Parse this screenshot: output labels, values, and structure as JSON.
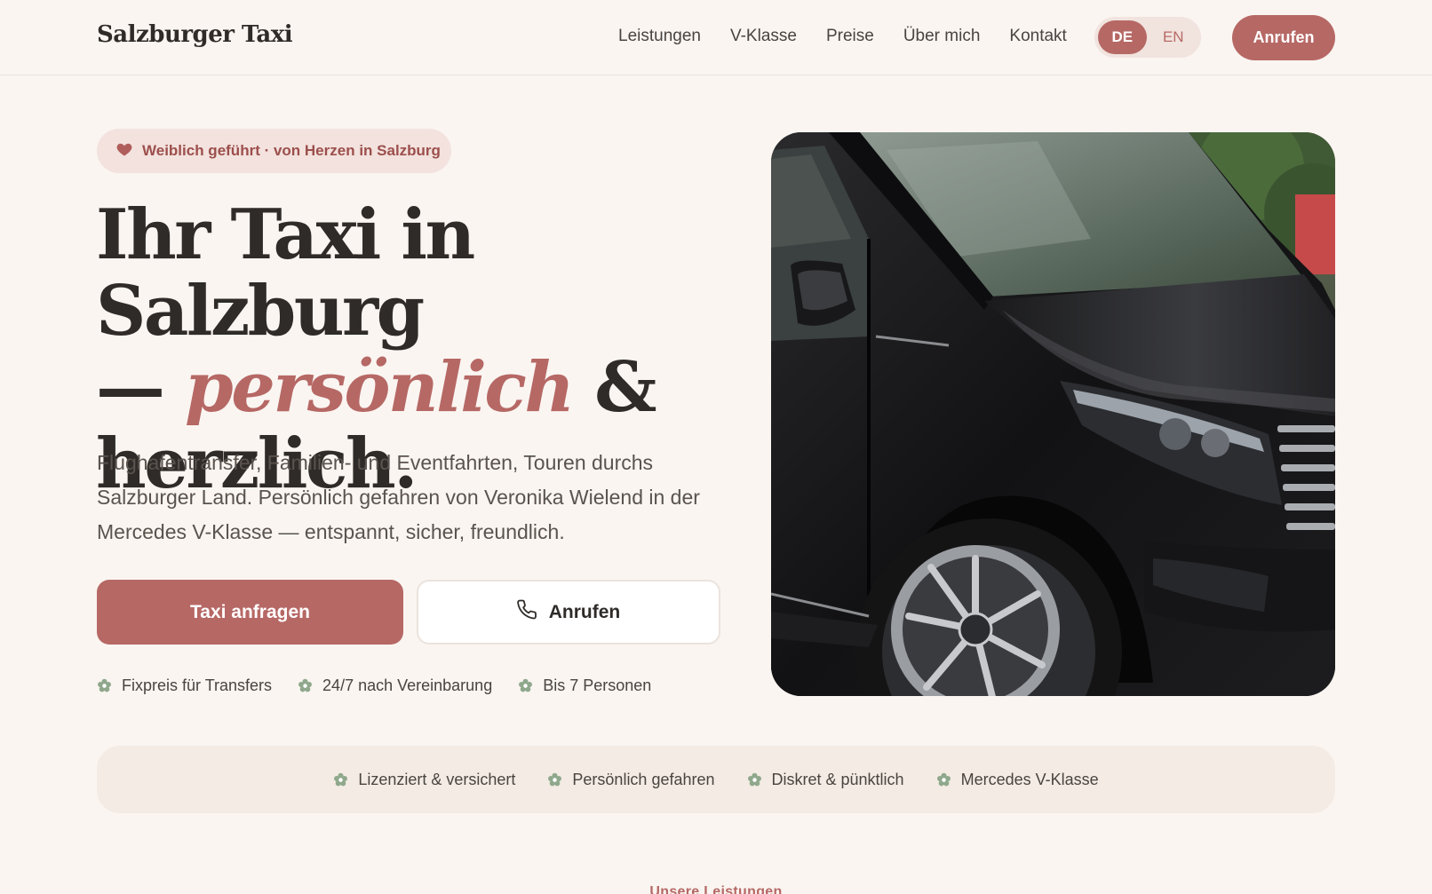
{
  "header": {
    "logo": "Salzburger Taxi",
    "nav": [
      "Leistungen",
      "V-Klasse",
      "Preise",
      "Über mich",
      "Kontakt"
    ],
    "lang": {
      "active": "DE",
      "other": "EN"
    },
    "call_label": "Anrufen"
  },
  "hero": {
    "badge": "Weiblich geführt · von Herzen in Salzburg",
    "headline_line1": "Ihr Taxi in Salzburg",
    "headline_dash": "— ",
    "headline_accent": "persönlich",
    "headline_amp": " &",
    "headline_line3": "herzlich.",
    "lead": "Flughafentransfer, Familien- und Eventfahrten, Touren durchs Salzburger Land. Persönlich gefahren von Veronika Wielend in der Mercedes V-Klasse — entspannt, sicher, freundlich.",
    "primary_cta": "Taxi anfragen",
    "secondary_cta": "Anrufen",
    "features": [
      "Fixpreis für Transfers",
      "24/7 nach Vereinbarung",
      "Bis 7 Personen"
    ]
  },
  "trust": [
    "Lizenziert & versichert",
    "Persönlich gefahren",
    "Diskret & pünktlich",
    "Mercedes V-Klasse"
  ],
  "next_section_label": "Unsere Leistungen",
  "colors": {
    "accent": "#b66865",
    "background": "#faf5f1",
    "badge_bg": "#f3e2de",
    "flower_icon": "#8fa88c",
    "text": "#2f2b28"
  }
}
